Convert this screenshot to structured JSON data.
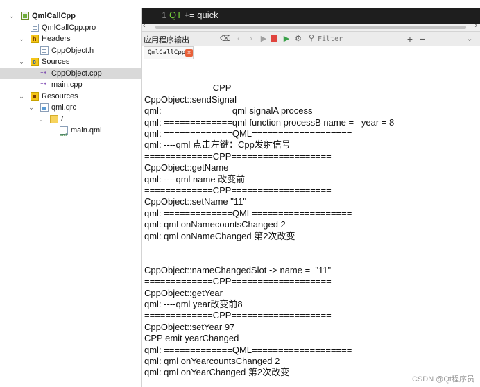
{
  "project_tree": {
    "items": [
      {
        "label": "QmlCallCpp",
        "icon": "qt-project-icon",
        "level": 0,
        "expanded": true,
        "bold": true
      },
      {
        "label": "QmlCallCpp.pro",
        "icon": "pro-file-icon",
        "level": 1
      },
      {
        "label": "Headers",
        "icon": "headers-folder-icon",
        "level": 1,
        "expanded": true
      },
      {
        "label": "CppObject.h",
        "icon": "header-file-icon",
        "level": 2
      },
      {
        "label": "Sources",
        "icon": "sources-folder-icon",
        "level": 1,
        "expanded": true
      },
      {
        "label": "CppObject.cpp",
        "icon": "cpp-file-icon",
        "level": 2,
        "selected": true
      },
      {
        "label": "main.cpp",
        "icon": "cpp-file-icon",
        "level": 2
      },
      {
        "label": "Resources",
        "icon": "resources-folder-icon",
        "level": 1,
        "expanded": true
      },
      {
        "label": "qml.qrc",
        "icon": "qrc-file-icon",
        "level": 2,
        "expanded": true
      },
      {
        "label": "/",
        "icon": "folder-icon",
        "level": 3,
        "expanded": true
      },
      {
        "label": "main.qml",
        "icon": "qml-file-icon",
        "level": 4
      }
    ]
  },
  "editor": {
    "line_number": "1",
    "code_keyword": "QT",
    "code_rest": " += quick"
  },
  "output_pane": {
    "title": "应用程序输出",
    "filter_placeholder": "Filter",
    "tab_label": "QmlCallCpp",
    "tab_close": "×"
  },
  "output_lines": [
    "",
    "=============CPP===================",
    "CppObject::sendSignal",
    "qml: =============qml signalA process",
    "qml: =============qml function processB name =   year = 8",
    "qml: =============QML===================",
    "qml: ----qml 点击左键：Cpp发射信号",
    "=============CPP===================",
    "CppObject::getName",
    "qml: ----qml name 改变前",
    "=============CPP===================",
    "CppObject::setName \"11\"",
    "qml: =============QML===================",
    "qml: qml onNamecountsChanged 2",
    "qml: qml onNameChanged 第2次改变",
    "",
    "",
    "CppObject::nameChangedSlot -> name =  \"11\"",
    "=============CPP===================",
    "CppObject::getYear",
    "qml: ----qml year改变前8",
    "=============CPP===================",
    "CppObject::setYear 97",
    "CPP emit yearChanged",
    "qml: =============QML===================",
    "qml: qml onYearcountsChanged 2",
    "qml: qml onYearChanged 第2次改变"
  ],
  "watermark": "CSDN @Qt程序员"
}
